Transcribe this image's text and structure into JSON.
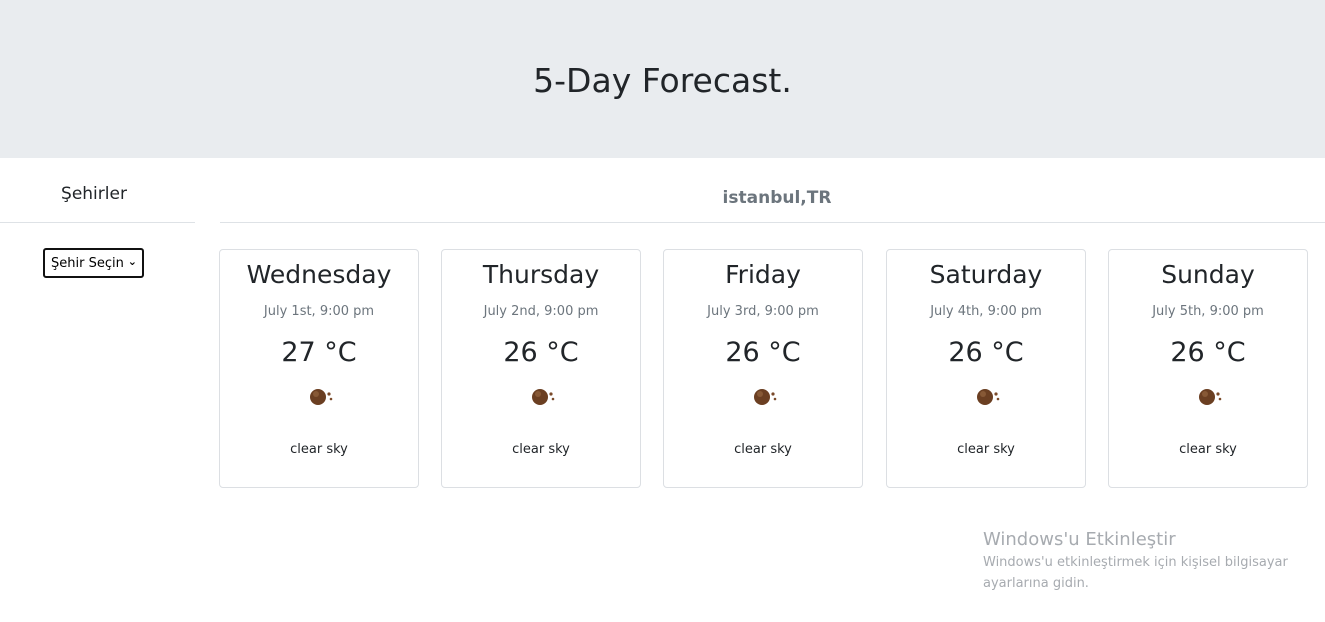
{
  "header": {
    "title": "5-Day Forecast."
  },
  "sidebar": {
    "title": "Şehirler",
    "select": {
      "selected": "Şehir Seçin"
    }
  },
  "main": {
    "city": "istanbul,TR"
  },
  "forecast": [
    {
      "day": "Wednesday",
      "date": "July 1st, 9:00 pm",
      "temp": "27 °C",
      "desc": "clear sky",
      "icon": "clear-sky-icon"
    },
    {
      "day": "Thursday",
      "date": "July 2nd, 9:00 pm",
      "temp": "26 °C",
      "desc": "clear sky",
      "icon": "clear-sky-icon"
    },
    {
      "day": "Friday",
      "date": "July 3rd, 9:00 pm",
      "temp": "26 °C",
      "desc": "clear sky",
      "icon": "clear-sky-icon"
    },
    {
      "day": "Saturday",
      "date": "July 4th, 9:00 pm",
      "temp": "26 °C",
      "desc": "clear sky",
      "icon": "clear-sky-icon"
    },
    {
      "day": "Sunday",
      "date": "July 5th, 9:00 pm",
      "temp": "26 °C",
      "desc": "clear sky",
      "icon": "clear-sky-icon"
    }
  ],
  "watermark": {
    "title": "Windows'u Etkinleştir",
    "line1": "Windows'u etkinleştirmek için kişisel bilgisayar",
    "line2": "ayarlarına gidin."
  },
  "colors": {
    "header_bg": "#e9ecef",
    "muted_text": "#6c757d",
    "card_border": "#dcdfe3"
  }
}
